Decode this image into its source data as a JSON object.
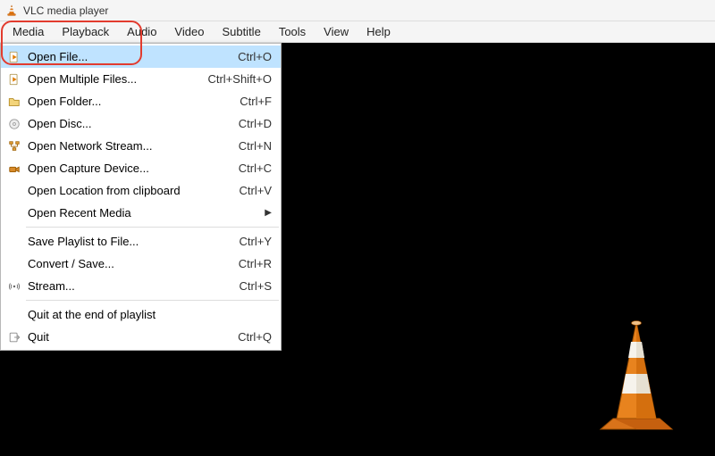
{
  "title": "VLC media player",
  "menubar": [
    {
      "label": "Media",
      "open": true
    },
    {
      "label": "Playback"
    },
    {
      "label": "Audio"
    },
    {
      "label": "Video"
    },
    {
      "label": "Subtitle"
    },
    {
      "label": "Tools"
    },
    {
      "label": "View"
    },
    {
      "label": "Help"
    }
  ],
  "media_menu": {
    "groups": [
      [
        {
          "icon": "file-play-icon",
          "label": "Open File...",
          "shortcut": "Ctrl+O",
          "highlight": true
        },
        {
          "icon": "file-play-icon",
          "label": "Open Multiple Files...",
          "shortcut": "Ctrl+Shift+O"
        },
        {
          "icon": "folder-icon",
          "label": "Open Folder...",
          "shortcut": "Ctrl+F"
        },
        {
          "icon": "disc-icon",
          "label": "Open Disc...",
          "shortcut": "Ctrl+D"
        },
        {
          "icon": "network-icon",
          "label": "Open Network Stream...",
          "shortcut": "Ctrl+N"
        },
        {
          "icon": "capture-icon",
          "label": "Open Capture Device...",
          "shortcut": "Ctrl+C"
        },
        {
          "icon": "",
          "label": "Open Location from clipboard",
          "shortcut": "Ctrl+V"
        },
        {
          "icon": "",
          "label": "Open Recent Media",
          "submenu": true
        }
      ],
      [
        {
          "icon": "",
          "label": "Save Playlist to File...",
          "shortcut": "Ctrl+Y"
        },
        {
          "icon": "",
          "label": "Convert / Save...",
          "shortcut": "Ctrl+R"
        },
        {
          "icon": "stream-icon",
          "label": "Stream...",
          "shortcut": "Ctrl+S"
        }
      ],
      [
        {
          "icon": "",
          "label": "Quit at the end of playlist"
        },
        {
          "icon": "quit-icon",
          "label": "Quit",
          "shortcut": "Ctrl+Q"
        }
      ]
    ]
  }
}
